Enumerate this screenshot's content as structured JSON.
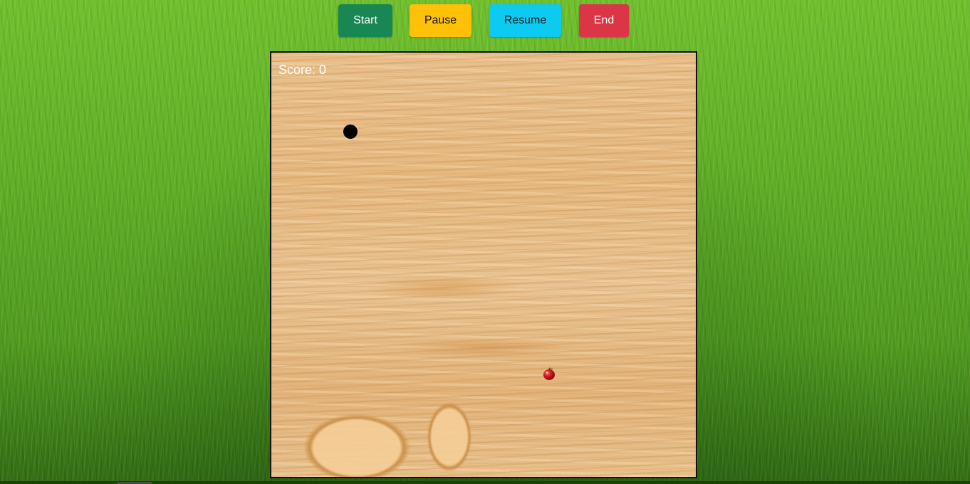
{
  "controls": {
    "start_label": "Start",
    "pause_label": "Pause",
    "resume_label": "Resume",
    "end_label": "End",
    "colors": {
      "start": "#198754",
      "pause": "#ffc107",
      "resume": "#0dcaf0",
      "end": "#dc3545"
    }
  },
  "game": {
    "score_label": "Score:",
    "score": "0",
    "snake_color": "#000000",
    "food_icon": "apple-icon",
    "board_texture": "wood",
    "background_texture": "grass"
  }
}
